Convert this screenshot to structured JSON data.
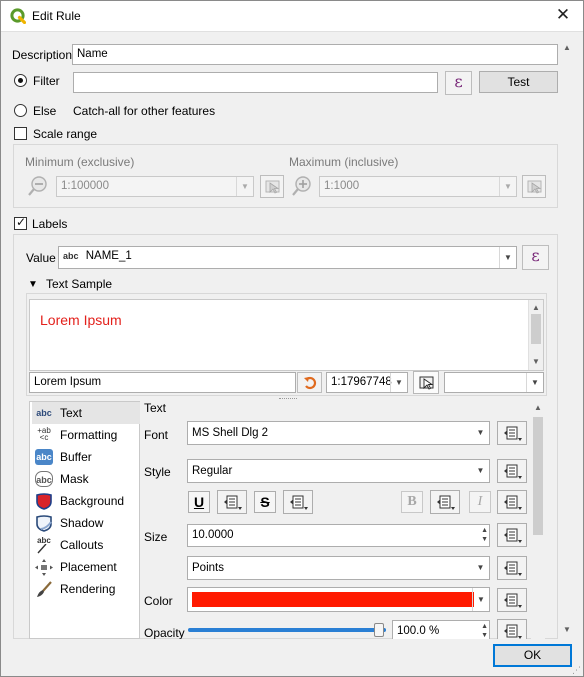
{
  "window": {
    "title": "Edit Rule",
    "close_glyph": "✕"
  },
  "description": {
    "label": "Description",
    "value": "Name"
  },
  "filter": {
    "label": "Filter",
    "value": "",
    "expression_icon": "ε",
    "test_label": "Test"
  },
  "else": {
    "label": "Else",
    "caption": "Catch-all for other features"
  },
  "scale_range": {
    "label": "Scale range",
    "minimum_label": "Minimum (exclusive)",
    "minimum_value": "1:100000",
    "maximum_label": "Maximum (inclusive)",
    "maximum_value": "1:1000"
  },
  "labels": {
    "label": "Labels",
    "value_label": "Value",
    "value_type_badge": "abc",
    "value_field": "NAME_1",
    "expression_icon": "ε"
  },
  "text_sample": {
    "header": "Text Sample",
    "preview_text": "Lorem Ipsum",
    "sample_input": "Lorem Ipsum",
    "scale_value": "1:17967748",
    "preview_color": "#e3211c"
  },
  "sidebar": {
    "items": [
      {
        "label": "Text",
        "icon": "abc-text-icon",
        "glyph": "abc"
      },
      {
        "label": "Formatting",
        "icon": "formatting-icon",
        "glyph": "+ab\n<c"
      },
      {
        "label": "Buffer",
        "icon": "buffer-icon",
        "glyph": "abc"
      },
      {
        "label": "Mask",
        "icon": "mask-icon",
        "glyph": "abc"
      },
      {
        "label": "Background",
        "icon": "background-icon",
        "glyph": ""
      },
      {
        "label": "Shadow",
        "icon": "shadow-icon",
        "glyph": ""
      },
      {
        "label": "Callouts",
        "icon": "callouts-icon",
        "glyph": "abc"
      },
      {
        "label": "Placement",
        "icon": "placement-icon",
        "glyph": ""
      },
      {
        "label": "Rendering",
        "icon": "rendering-icon",
        "glyph": ""
      }
    ]
  },
  "text_panel": {
    "section_title": "Text",
    "font_label": "Font",
    "font_value": "MS Shell Dlg 2",
    "style_label": "Style",
    "style_value": "Regular",
    "underline_glyph": "U",
    "strike_glyph": "S",
    "bold_glyph": "B",
    "italic_glyph": "I",
    "size_label": "Size",
    "size_value": "10.0000",
    "unit_value": "Points",
    "color_label": "Color",
    "color_value": "#ff1a00",
    "opacity_label": "Opacity",
    "opacity_value": "100.0 %",
    "opacity_fraction": 1.0
  },
  "footer": {
    "ok_label": "OK"
  }
}
